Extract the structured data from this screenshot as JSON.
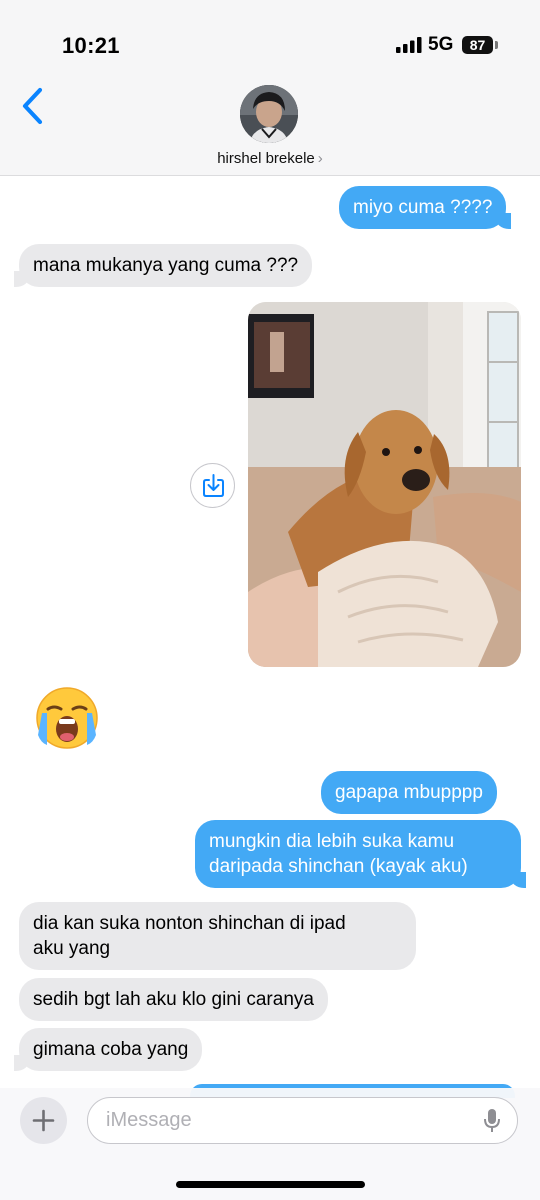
{
  "status_bar": {
    "time": "10:21",
    "network": "5G",
    "battery": "87"
  },
  "header": {
    "contact_name": "hirshel brekele",
    "chevron": "›"
  },
  "messages": [
    {
      "side": "sent",
      "text": "miyo cuma ????"
    },
    {
      "side": "received",
      "text": "mana mukanya yang cuma ???"
    },
    {
      "side": "received",
      "type": "photo",
      "subject": "golden retriever"
    },
    {
      "side": "received",
      "type": "emoji",
      "emoji": "loudly-crying-face"
    },
    {
      "side": "sent",
      "text": "gapapa mbupppp"
    },
    {
      "side": "sent",
      "lines": [
        "mungkin dia lebih suka kamu",
        "daripada shinchan (kayak aku)"
      ]
    },
    {
      "side": "received",
      "lines": [
        "dia kan suka nonton shinchan di ipad",
        "aku yang"
      ]
    },
    {
      "side": "received",
      "text": "sedih bgt lah aku klo gini caranya"
    },
    {
      "side": "received",
      "text": "gimana coba yang"
    }
  ],
  "composer": {
    "placeholder": "iMessage"
  },
  "colors": {
    "sent_bubble": "#43a9f5",
    "received_bubble": "#e9e9eb",
    "accent": "#0a84ff"
  }
}
